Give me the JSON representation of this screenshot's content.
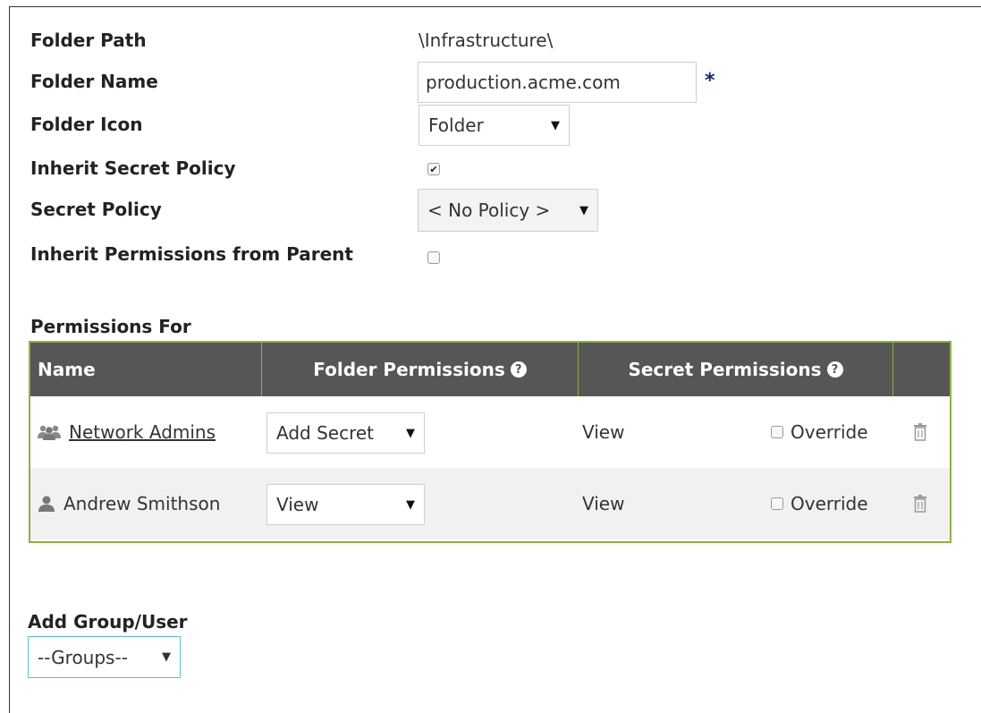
{
  "form": {
    "folder_path_label": "Folder Path",
    "folder_path_value": "\\Infrastructure\\",
    "folder_name_label": "Folder Name",
    "folder_name_value": "production.acme.com",
    "required_marker": "*",
    "folder_icon_label": "Folder Icon",
    "folder_icon_value": "Folder",
    "inherit_policy_label": "Inherit Secret Policy",
    "inherit_policy_checked": true,
    "secret_policy_label": "Secret Policy",
    "secret_policy_value": "< No Policy >",
    "inherit_permissions_label": "Inherit Permissions from Parent",
    "inherit_permissions_checked": false
  },
  "permissions": {
    "section_title": "Permissions For",
    "columns": [
      "Name",
      "Folder Permissions",
      "Secret Permissions",
      ""
    ],
    "rows": [
      {
        "name": "Network Admins",
        "type": "group",
        "icon": "group-icon",
        "folder_permission": "Add Secret",
        "secret_permission": "View",
        "override_label": "Override",
        "override_checked": false
      },
      {
        "name": "Andrew Smithson",
        "type": "user",
        "icon": "user-icon",
        "folder_permission": "View",
        "secret_permission": "View",
        "override_label": "Override",
        "override_checked": false
      }
    ]
  },
  "add": {
    "title": "Add Group/User",
    "select_value": "--Groups--"
  },
  "colors": {
    "header_bg": "#565656",
    "table_border": "#8ab43f",
    "select_focus_border": "#5bc0de",
    "required_star": "#1a2a6b"
  }
}
